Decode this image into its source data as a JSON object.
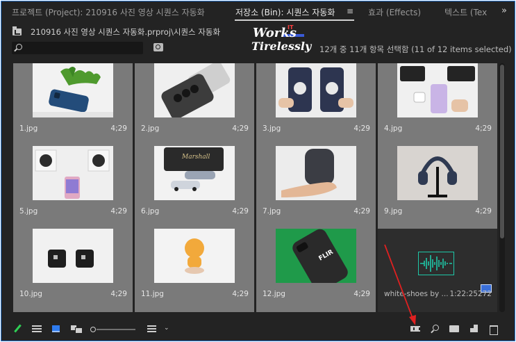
{
  "tabs": [
    {
      "label": "프로젝트 (Project): 210916 사진 영상 시퀀스 자동화",
      "active": false
    },
    {
      "label": "저장소 (Bin): 시퀀스 자동화",
      "active": true
    },
    {
      "label": "효과 (Effects)",
      "active": false
    },
    {
      "label": "텍스트 (Tex",
      "active": false
    }
  ],
  "tab_menu_icon": "≡",
  "tab_overflow_icon": "»",
  "path": "210916 사진 영상 시퀀스 자동화.prproj\\시퀀스 자동화",
  "search": {
    "value": "",
    "placeholder": ""
  },
  "selection_count": "12개 중 11개 항목 선택함 (11 of 12 items selected)",
  "watermark": {
    "line1": "Works",
    "superscript": "IT",
    "line2": "Tirelessly"
  },
  "items": [
    {
      "name": "1.jpg",
      "duration": "4;29"
    },
    {
      "name": "2.jpg",
      "duration": "4;29"
    },
    {
      "name": "3.jpg",
      "duration": "4;29"
    },
    {
      "name": "4.jpg",
      "duration": "4;29"
    },
    {
      "name": "5.jpg",
      "duration": "4;29"
    },
    {
      "name": "6.jpg",
      "duration": "4;29"
    },
    {
      "name": "7.jpg",
      "duration": "4;29"
    },
    {
      "name": "9.jpg",
      "duration": "4;29"
    },
    {
      "name": "10.jpg",
      "duration": "4;29"
    },
    {
      "name": "11.jpg",
      "duration": "4;29"
    },
    {
      "name": "12.jpg",
      "duration": "4;29"
    },
    {
      "name": "white-shoes by ...",
      "duration": "1:22:25272"
    }
  ],
  "colors": {
    "accent": "#2f7cf0",
    "panel": "#232323",
    "selected_tile": "#7a7a7a",
    "waveform": "#1ec8a8",
    "annotation_arrow": "#e02020"
  },
  "toolbar_icons": [
    "pencil-icon",
    "list-view-icon",
    "icon-view-icon",
    "freeform-view-icon",
    "zoom-slider",
    "sort-icon",
    "automate-to-sequence-icon",
    "find-icon",
    "new-bin-icon",
    "new-item-icon",
    "trash-icon"
  ]
}
